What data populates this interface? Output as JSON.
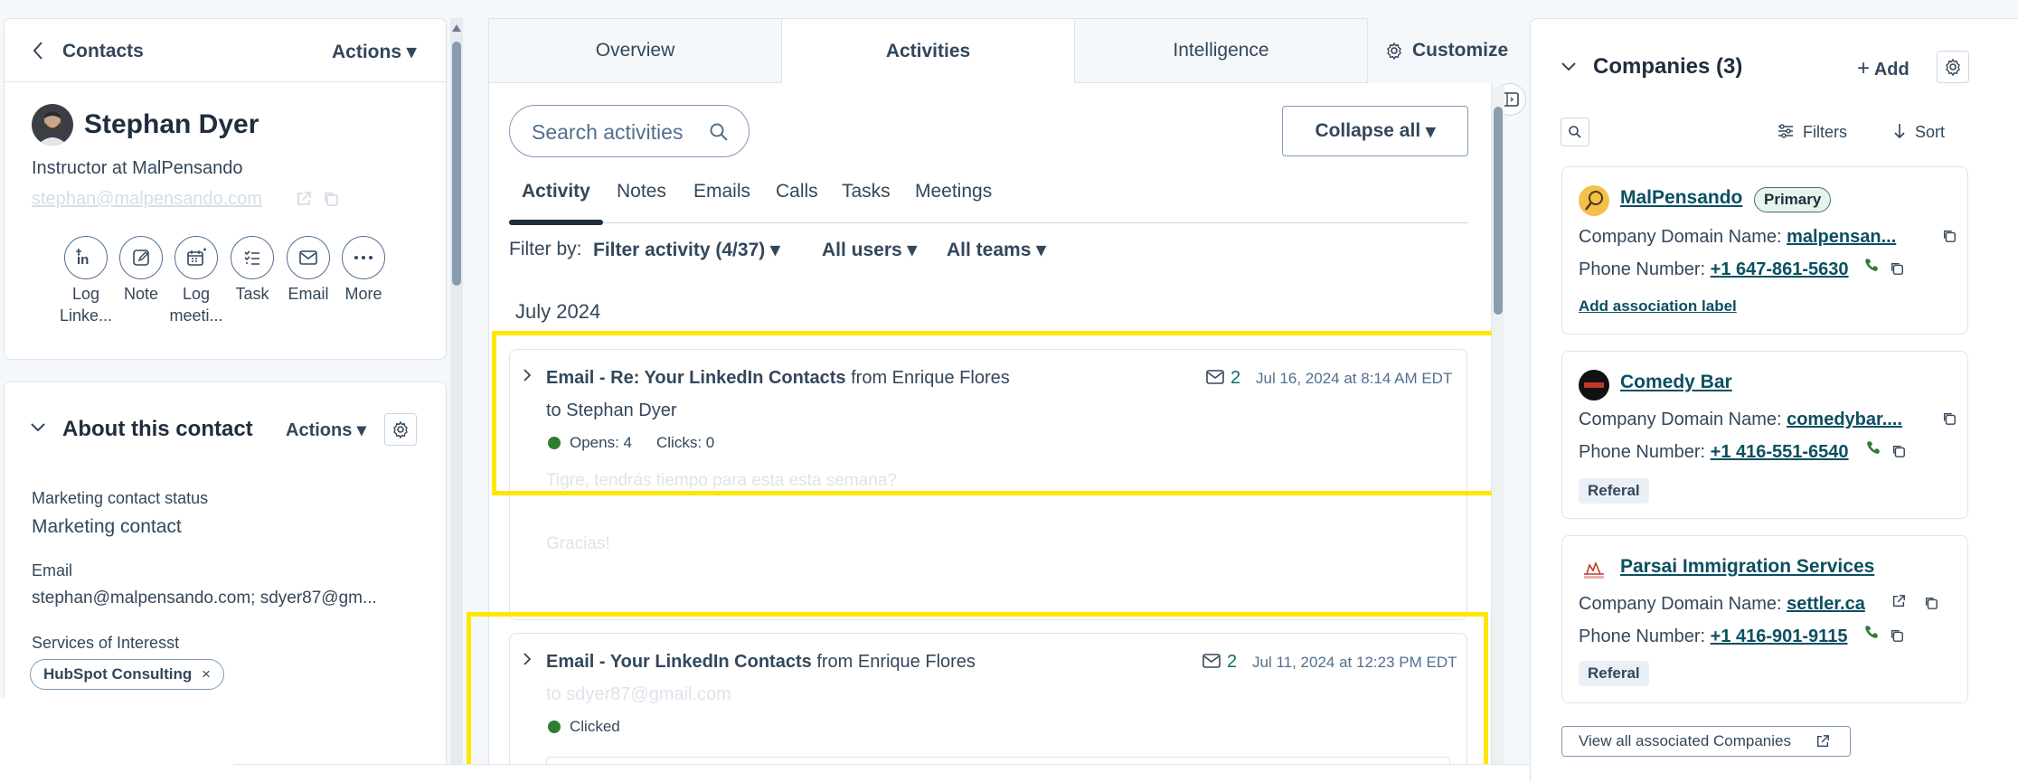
{
  "left": {
    "back_label": "Contacts",
    "actions_label": "Actions",
    "contact": {
      "name": "Stephan Dyer",
      "title": "Instructor at MalPensando",
      "email": "stephan@malpensando.com"
    },
    "actions": [
      {
        "label": "Log\nLinke...",
        "icon": "linkedin-log-icon"
      },
      {
        "label": "Note",
        "icon": "note-icon"
      },
      {
        "label": "Log\nmeeti...",
        "icon": "meeting-icon"
      },
      {
        "label": "Task",
        "icon": "task-icon"
      },
      {
        "label": "Email",
        "icon": "email-icon"
      },
      {
        "label": "More",
        "icon": "more-icon"
      }
    ],
    "about": {
      "title": "About this contact",
      "actions_label": "Actions",
      "marketing_label": "Marketing contact status",
      "marketing_value": "Marketing contact",
      "email_label": "Email",
      "email_value": "stephan@malpensando.com; sdyer87@gm...",
      "services_label": "Services of Interesst",
      "services_tag": "HubSpot Consulting"
    }
  },
  "tabs": {
    "overview": "Overview",
    "activities": "Activities",
    "intelligence": "Intelligence",
    "customize": "Customize"
  },
  "middle": {
    "search_placeholder": "Search activities",
    "collapse_label": "Collapse all",
    "subtabs": [
      "Activity",
      "Notes",
      "Emails",
      "Calls",
      "Tasks",
      "Meetings"
    ],
    "filter_by": "Filter by:",
    "filter_activity": "Filter activity (4/37)",
    "all_users": "All users",
    "all_teams": "All teams",
    "month": "July 2024",
    "activities": [
      {
        "title": "Email - Re: Your LinkedIn Contacts",
        "from": "from Enrique Flores",
        "to": "to Stephan Dyer",
        "count": "2",
        "date": "Jul 16, 2024 at 8:14 AM EDT",
        "stat1": "Opens: 4",
        "stat2": "Clicks: 0",
        "body1": "Tigre, tendrás tiempo para esta esta semana?",
        "body2": "Gracias!"
      },
      {
        "title": "Email - Your LinkedIn Contacts",
        "from": "from Enrique Flores",
        "to": "to sdyer87@gmail.com",
        "count": "2",
        "date": "Jul 11, 2024 at 12:23 PM EDT",
        "stat1": "Clicked"
      }
    ]
  },
  "right": {
    "title": "Companies (3)",
    "add_label": "Add",
    "filters_label": "Filters",
    "sort_label": "Sort",
    "domain_label": "Company Domain Name:",
    "phone_label": "Phone Number:",
    "companies": [
      {
        "name": "MalPensando",
        "badge": "Primary",
        "domain": "malpensan...",
        "phone": "+1 647-861-5630",
        "extra": "Add association label"
      },
      {
        "name": "Comedy Bar",
        "domain": "comedybar....",
        "phone": "+1 416-551-6540",
        "extra": "Referal"
      },
      {
        "name": "Parsai Immigration Services",
        "domain": "settler.ca",
        "phone": "+1 416-901-9115",
        "extra": "Referal"
      }
    ],
    "view_all": "View all associated Companies"
  },
  "colors": {
    "highlight": "#ffe600",
    "link": "#0b4f60",
    "green_dot": "#2e7d32"
  }
}
